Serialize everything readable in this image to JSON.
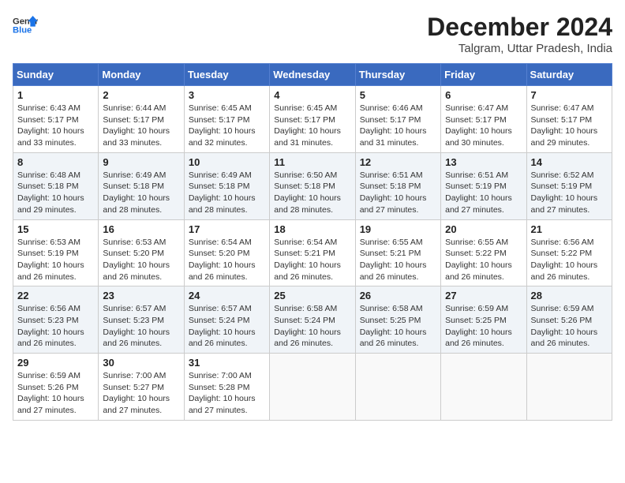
{
  "header": {
    "logo_line1": "General",
    "logo_line2": "Blue",
    "month_year": "December 2024",
    "location": "Talgram, Uttar Pradesh, India"
  },
  "calendar": {
    "days_of_week": [
      "Sunday",
      "Monday",
      "Tuesday",
      "Wednesday",
      "Thursday",
      "Friday",
      "Saturday"
    ],
    "weeks": [
      [
        {
          "day": "",
          "content": ""
        },
        {
          "day": "2",
          "content": "Sunrise: 6:44 AM\nSunset: 5:17 PM\nDaylight: 10 hours\nand 33 minutes."
        },
        {
          "day": "3",
          "content": "Sunrise: 6:45 AM\nSunset: 5:17 PM\nDaylight: 10 hours\nand 32 minutes."
        },
        {
          "day": "4",
          "content": "Sunrise: 6:45 AM\nSunset: 5:17 PM\nDaylight: 10 hours\nand 31 minutes."
        },
        {
          "day": "5",
          "content": "Sunrise: 6:46 AM\nSunset: 5:17 PM\nDaylight: 10 hours\nand 31 minutes."
        },
        {
          "day": "6",
          "content": "Sunrise: 6:47 AM\nSunset: 5:17 PM\nDaylight: 10 hours\nand 30 minutes."
        },
        {
          "day": "7",
          "content": "Sunrise: 6:47 AM\nSunset: 5:17 PM\nDaylight: 10 hours\nand 29 minutes."
        }
      ],
      [
        {
          "day": "1",
          "content": "Sunrise: 6:43 AM\nSunset: 5:17 PM\nDaylight: 10 hours\nand 33 minutes.",
          "first_week_sunday": true
        },
        {
          "day": "9",
          "content": "Sunrise: 6:49 AM\nSunset: 5:18 PM\nDaylight: 10 hours\nand 28 minutes."
        },
        {
          "day": "10",
          "content": "Sunrise: 6:49 AM\nSunset: 5:18 PM\nDaylight: 10 hours\nand 28 minutes."
        },
        {
          "day": "11",
          "content": "Sunrise: 6:50 AM\nSunset: 5:18 PM\nDaylight: 10 hours\nand 28 minutes."
        },
        {
          "day": "12",
          "content": "Sunrise: 6:51 AM\nSunset: 5:18 PM\nDaylight: 10 hours\nand 27 minutes."
        },
        {
          "day": "13",
          "content": "Sunrise: 6:51 AM\nSunset: 5:19 PM\nDaylight: 10 hours\nand 27 minutes."
        },
        {
          "day": "14",
          "content": "Sunrise: 6:52 AM\nSunset: 5:19 PM\nDaylight: 10 hours\nand 27 minutes."
        }
      ],
      [
        {
          "day": "8",
          "content": "Sunrise: 6:48 AM\nSunset: 5:18 PM\nDaylight: 10 hours\nand 29 minutes.",
          "week3_sunday": true
        },
        {
          "day": "16",
          "content": "Sunrise: 6:53 AM\nSunset: 5:20 PM\nDaylight: 10 hours\nand 26 minutes."
        },
        {
          "day": "17",
          "content": "Sunrise: 6:54 AM\nSunset: 5:20 PM\nDaylight: 10 hours\nand 26 minutes."
        },
        {
          "day": "18",
          "content": "Sunrise: 6:54 AM\nSunset: 5:21 PM\nDaylight: 10 hours\nand 26 minutes."
        },
        {
          "day": "19",
          "content": "Sunrise: 6:55 AM\nSunset: 5:21 PM\nDaylight: 10 hours\nand 26 minutes."
        },
        {
          "day": "20",
          "content": "Sunrise: 6:55 AM\nSunset: 5:22 PM\nDaylight: 10 hours\nand 26 minutes."
        },
        {
          "day": "21",
          "content": "Sunrise: 6:56 AM\nSunset: 5:22 PM\nDaylight: 10 hours\nand 26 minutes."
        }
      ],
      [
        {
          "day": "15",
          "content": "Sunrise: 6:53 AM\nSunset: 5:19 PM\nDaylight: 10 hours\nand 26 minutes.",
          "week4_sunday": true
        },
        {
          "day": "23",
          "content": "Sunrise: 6:57 AM\nSunset: 5:23 PM\nDaylight: 10 hours\nand 26 minutes."
        },
        {
          "day": "24",
          "content": "Sunrise: 6:57 AM\nSunset: 5:24 PM\nDaylight: 10 hours\nand 26 minutes."
        },
        {
          "day": "25",
          "content": "Sunrise: 6:58 AM\nSunset: 5:24 PM\nDaylight: 10 hours\nand 26 minutes."
        },
        {
          "day": "26",
          "content": "Sunrise: 6:58 AM\nSunset: 5:25 PM\nDaylight: 10 hours\nand 26 minutes."
        },
        {
          "day": "27",
          "content": "Sunrise: 6:59 AM\nSunset: 5:25 PM\nDaylight: 10 hours\nand 26 minutes."
        },
        {
          "day": "28",
          "content": "Sunrise: 6:59 AM\nSunset: 5:26 PM\nDaylight: 10 hours\nand 26 minutes."
        }
      ],
      [
        {
          "day": "22",
          "content": "Sunrise: 6:56 AM\nSunset: 5:23 PM\nDaylight: 10 hours\nand 26 minutes.",
          "week5_sunday": true
        },
        {
          "day": "30",
          "content": "Sunrise: 7:00 AM\nSunset: 5:27 PM\nDaylight: 10 hours\nand 27 minutes."
        },
        {
          "day": "31",
          "content": "Sunrise: 7:00 AM\nSunset: 5:28 PM\nDaylight: 10 hours\nand 27 minutes."
        },
        {
          "day": "",
          "content": ""
        },
        {
          "day": "",
          "content": ""
        },
        {
          "day": "",
          "content": ""
        },
        {
          "day": "",
          "content": ""
        }
      ],
      [
        {
          "day": "29",
          "content": "Sunrise: 6:59 AM\nSunset: 5:26 PM\nDaylight: 10 hours\nand 27 minutes.",
          "week6_sunday": true
        },
        {
          "day": "",
          "content": ""
        },
        {
          "day": "",
          "content": ""
        },
        {
          "day": "",
          "content": ""
        },
        {
          "day": "",
          "content": ""
        },
        {
          "day": "",
          "content": ""
        },
        {
          "day": "",
          "content": ""
        }
      ]
    ]
  }
}
